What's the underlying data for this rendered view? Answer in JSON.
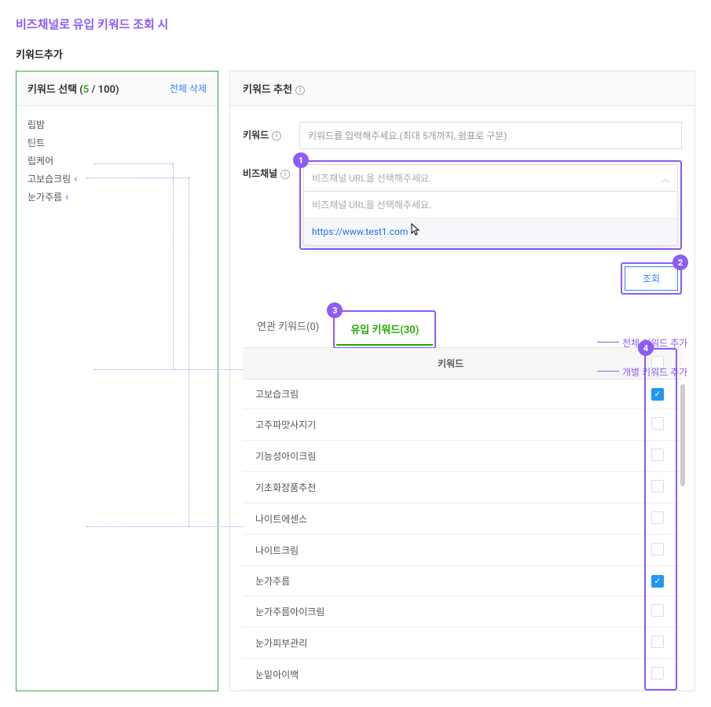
{
  "page_title": "비즈채널로 유입 키워드 조회 시",
  "subtitle": "키워드추가",
  "left": {
    "title_prefix": "키워드 선택 (",
    "count": "5",
    "count_sep": " / ",
    "count_max": "100",
    "title_suffix": ")",
    "delete_all": "전체 삭제",
    "items": [
      "립밤",
      "틴트",
      "립케어",
      "고보습크림",
      "눈가주름"
    ]
  },
  "right": {
    "header": "키워드 추천",
    "keyword_label": "키워드",
    "keyword_placeholder": "키워드를 입력해주세요.(최대 5개까지, 쉼표로 구분)",
    "bizchannel_label": "비즈채널",
    "bizchannel_placeholder": "비즈채널 URL을 선택해주세요.",
    "dropdown_hint": "비즈채널 URL을 선택해주세요.",
    "dropdown_item": "https://www.test1.com",
    "search_btn": "조회",
    "tabs": {
      "related": "연관 키워드(0)",
      "inflow": "유입 키워드(30)"
    },
    "table_header": "키워드",
    "rows": [
      {
        "kw": "고보습크림",
        "checked": true
      },
      {
        "kw": "고주파맛사지기",
        "checked": false
      },
      {
        "kw": "기능성아이크림",
        "checked": false
      },
      {
        "kw": "기초화장품추천",
        "checked": false
      },
      {
        "kw": "나이트에센스",
        "checked": false
      },
      {
        "kw": "나이트크림",
        "checked": false
      },
      {
        "kw": "눈가주름",
        "checked": true
      },
      {
        "kw": "눈가주름아이크림",
        "checked": false
      },
      {
        "kw": "눈가피부관리",
        "checked": false
      },
      {
        "kw": "눈밑아이백",
        "checked": false
      }
    ]
  },
  "annotations": {
    "all_add": "전체 키워드 추가",
    "single_add": "개별 키워드 추가"
  },
  "badges": [
    "1",
    "2",
    "3",
    "4"
  ]
}
